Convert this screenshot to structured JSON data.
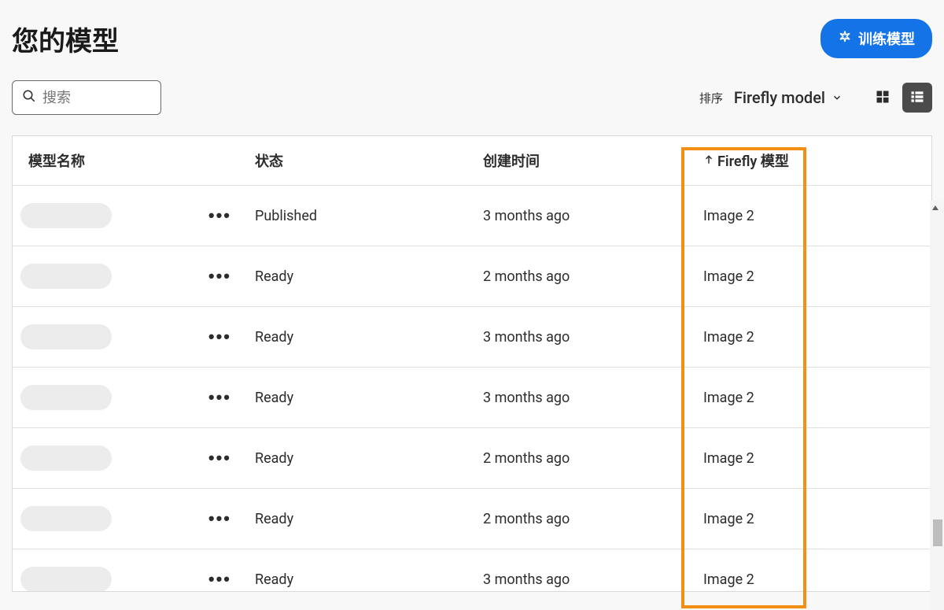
{
  "header": {
    "title": "您的模型",
    "train_button_label": "训练模型"
  },
  "search": {
    "placeholder": "搜索"
  },
  "sort": {
    "label": "排序",
    "selected": "Firefly model"
  },
  "table": {
    "columns": {
      "name": "模型名称",
      "status": "状态",
      "created": "创建时间",
      "model": "Firefly 模型"
    },
    "rows": [
      {
        "status": "Published",
        "created": "3 months ago",
        "model": "Image 2"
      },
      {
        "status": "Ready",
        "created": "2 months ago",
        "model": "Image 2"
      },
      {
        "status": "Ready",
        "created": "3 months ago",
        "model": "Image 2"
      },
      {
        "status": "Ready",
        "created": "3 months ago",
        "model": "Image 2"
      },
      {
        "status": "Ready",
        "created": "2 months ago",
        "model": "Image 2"
      },
      {
        "status": "Ready",
        "created": "2 months ago",
        "model": "Image 2"
      },
      {
        "status": "Ready",
        "created": "3 months ago",
        "model": "Image 2"
      }
    ]
  }
}
